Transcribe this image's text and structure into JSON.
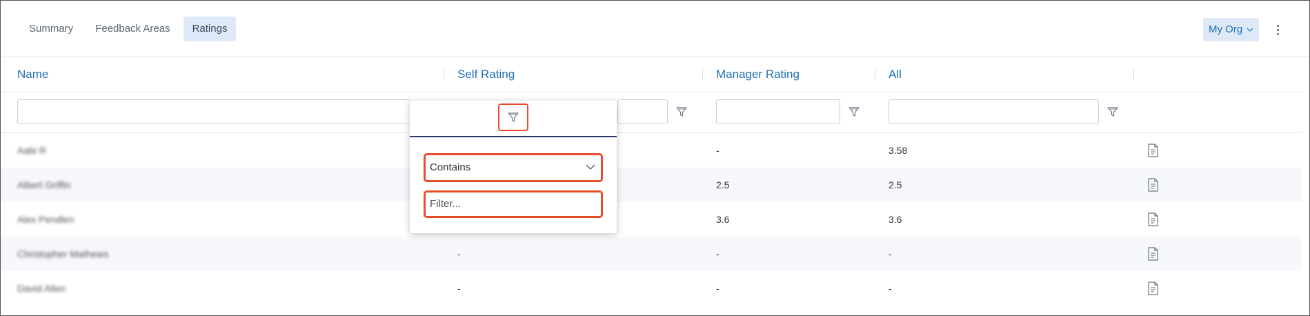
{
  "tabs": [
    {
      "label": "Summary"
    },
    {
      "label": "Feedback Areas"
    },
    {
      "label": "Ratings"
    }
  ],
  "active_tab": "Ratings",
  "org_selector": {
    "label": "My Org"
  },
  "table": {
    "columns": [
      "Name",
      "Self Rating",
      "Manager Rating",
      "All"
    ],
    "rows": [
      {
        "name": "Aabi R",
        "self": "",
        "manager": "-",
        "all": "3.58"
      },
      {
        "name": "Albert Griffin",
        "self": "",
        "manager": "2.5",
        "all": "2.5"
      },
      {
        "name": "Alex Pendlen",
        "self": "",
        "manager": "3.6",
        "all": "3.6"
      },
      {
        "name": "Christopher Mathews",
        "self": "-",
        "manager": "-",
        "all": "-"
      },
      {
        "name": "David Allen",
        "self": "-",
        "manager": "-",
        "all": "-"
      }
    ]
  },
  "filter_popup": {
    "operator": "Contains",
    "placeholder": "Filter..."
  },
  "colors": {
    "accent": "#1f6fb3",
    "highlight": "#e84d2a",
    "active_tab_bg": "#dde9f7"
  }
}
